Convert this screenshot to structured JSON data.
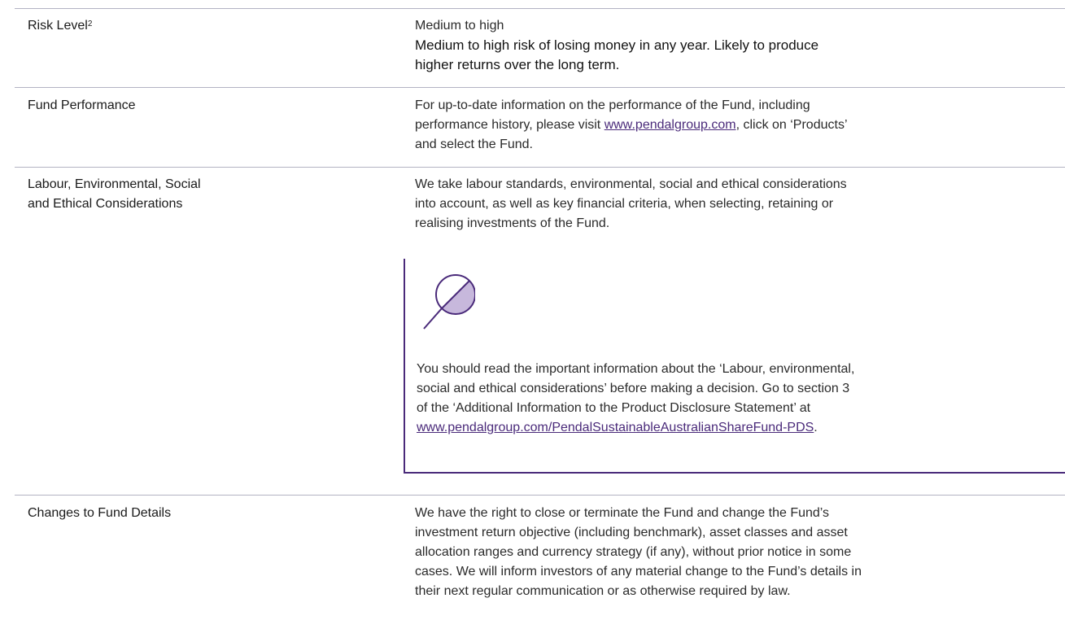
{
  "rows": [
    {
      "label": "Risk Level",
      "label_sup": "2",
      "level": "Medium to high",
      "description_line1": "Medium to high risk of losing money in any year. Likely to produce",
      "description_line2": "higher returns over the long term."
    },
    {
      "label": "Fund Performance",
      "text_line1": "For up-to-date information on the performance of the Fund, including",
      "text_line2_pre": "performance history, please visit ",
      "link": "www.pendalgroup.com",
      "text_line2_post": ", click on ‘Products’",
      "text_line3": "and select the Fund."
    },
    {
      "label_line1": "Labour, Environmental, Social",
      "label_line2": "and Ethical Considerations",
      "text_line1": "We take labour standards, environmental, social and ethical considerations",
      "text_line2": "into account, as well as key financial criteria, when selecting, retaining or",
      "text_line3": "realising investments of the Fund.",
      "callout": {
        "icon": "magnifier-icon",
        "line1": "You should read the important information about the ‘Labour, environmental,",
        "line2": "social and ethical considerations’ before making a decision. Go to section 3",
        "line3": "of the ‘Additional Information to the Product Disclosure Statement’ at",
        "link": "www.pendalgroup.com/PendalSustainableAustralianShareFund-PDS",
        "link_post": "."
      }
    },
    {
      "label": "Changes to Fund Details",
      "text_line1": "We have the right to close or terminate the Fund and change the Fund’s",
      "text_line2": "investment return objective (including benchmark), asset classes and asset",
      "text_line3": "allocation ranges and currency strategy (if any), without prior notice in some",
      "text_line4": "cases. We will inform investors of any material change to the Fund’s details in",
      "text_line5": "their next regular communication or as otherwise required by law."
    }
  ],
  "colors": {
    "accent": "#4a2a7a",
    "rule": "#b3b3c3"
  }
}
